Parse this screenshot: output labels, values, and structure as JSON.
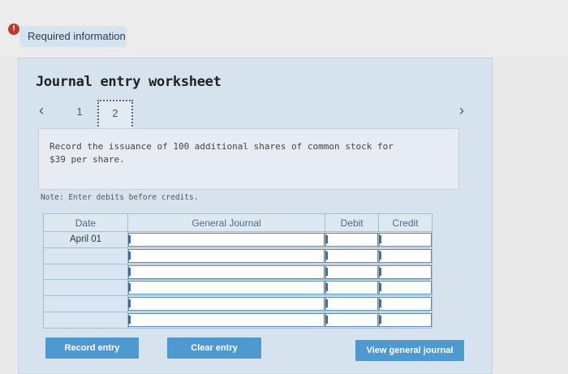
{
  "header": {
    "required_label": "Required information"
  },
  "worksheet": {
    "title": "Journal entry worksheet",
    "steps": [
      "1",
      "2"
    ],
    "current_step": "2",
    "instruction": "Record the issuance of 100 additional shares of common stock for $39 per share.",
    "note": "Note: Enter debits before credits."
  },
  "table": {
    "columns": [
      "Date",
      "General Journal",
      "Debit",
      "Credit"
    ],
    "rows": [
      {
        "date": "April 01",
        "account": "",
        "debit": "",
        "credit": ""
      },
      {
        "date": "",
        "account": "",
        "debit": "",
        "credit": ""
      },
      {
        "date": "",
        "account": "",
        "debit": "",
        "credit": ""
      },
      {
        "date": "",
        "account": "",
        "debit": "",
        "credit": ""
      },
      {
        "date": "",
        "account": "",
        "debit": "",
        "credit": ""
      },
      {
        "date": "",
        "account": "",
        "debit": "",
        "credit": ""
      }
    ]
  },
  "buttons": {
    "record": "Record entry",
    "clear": "Clear entry",
    "view": "View general journal"
  },
  "icons": {
    "alert": "alert-icon",
    "prev": "chevron-left-icon",
    "next": "chevron-right-icon"
  },
  "colors": {
    "button": "#4f99d1",
    "panel": "#d6e2ed",
    "alert": "#b73b35"
  }
}
